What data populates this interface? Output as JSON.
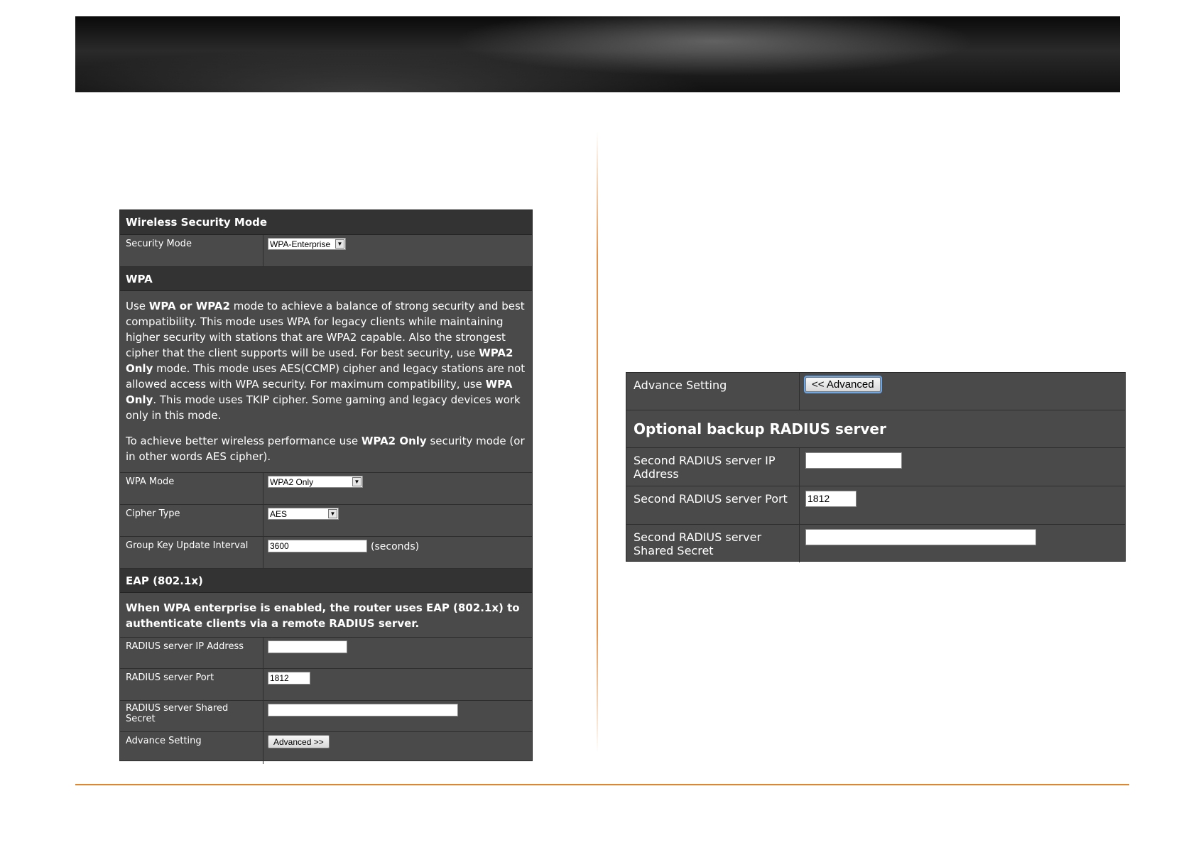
{
  "left": {
    "wireless_security_mode": {
      "title": "Wireless Security Mode",
      "security_mode_label": "Security Mode",
      "security_mode_value": "WPA-Enterprise"
    },
    "wpa": {
      "title": "WPA",
      "desc1_parts": [
        "Use ",
        "WPA or WPA2",
        " mode to achieve a balance of strong security and best compatibility. This mode uses WPA for legacy clients while maintaining higher security with stations that are WPA2 capable. Also the strongest cipher that the client supports will be used. For best security, use ",
        "WPA2 Only",
        " mode. This mode uses AES(CCMP) cipher and legacy stations are not allowed access with WPA security. For maximum compatibility, use ",
        "WPA Only",
        ". This mode uses TKIP cipher. Some gaming and legacy devices work only in this mode."
      ],
      "desc2_parts": [
        "To achieve better wireless performance use ",
        "WPA2 Only",
        " security mode (or in other words AES cipher)."
      ],
      "wpa_mode_label": "WPA Mode",
      "wpa_mode_value": "WPA2 Only",
      "cipher_type_label": "Cipher Type",
      "cipher_type_value": "AES",
      "group_key_label": "Group Key Update Interval",
      "group_key_value": "3600",
      "group_key_unit": "(seconds)"
    },
    "eap": {
      "title": "EAP (802.1x)",
      "desc": "When WPA enterprise is enabled, the router uses EAP (802.1x) to authenticate clients via a remote RADIUS server.",
      "radius_ip_label": "RADIUS server IP Address",
      "radius_ip_value": "",
      "radius_port_label": "RADIUS server Port",
      "radius_port_value": "1812",
      "radius_secret_label": "RADIUS server Shared Secret",
      "radius_secret_value": "",
      "advance_setting_label": "Advance Setting",
      "advanced_button": "Advanced >>"
    }
  },
  "right": {
    "advance_setting_label": "Advance Setting",
    "advanced_button": "<< Advanced",
    "backup_title": "Optional backup RADIUS server",
    "second_ip_label": "Second RADIUS server IP Address",
    "second_ip_value": "",
    "second_port_label": "Second RADIUS server Port",
    "second_port_value": "1812",
    "second_secret_label": "Second RADIUS server Shared Secret",
    "second_secret_value": ""
  },
  "colors": {
    "panel_bg": "#4a4a4a",
    "header_bg": "#333333",
    "accent_orange": "#e0842e"
  }
}
